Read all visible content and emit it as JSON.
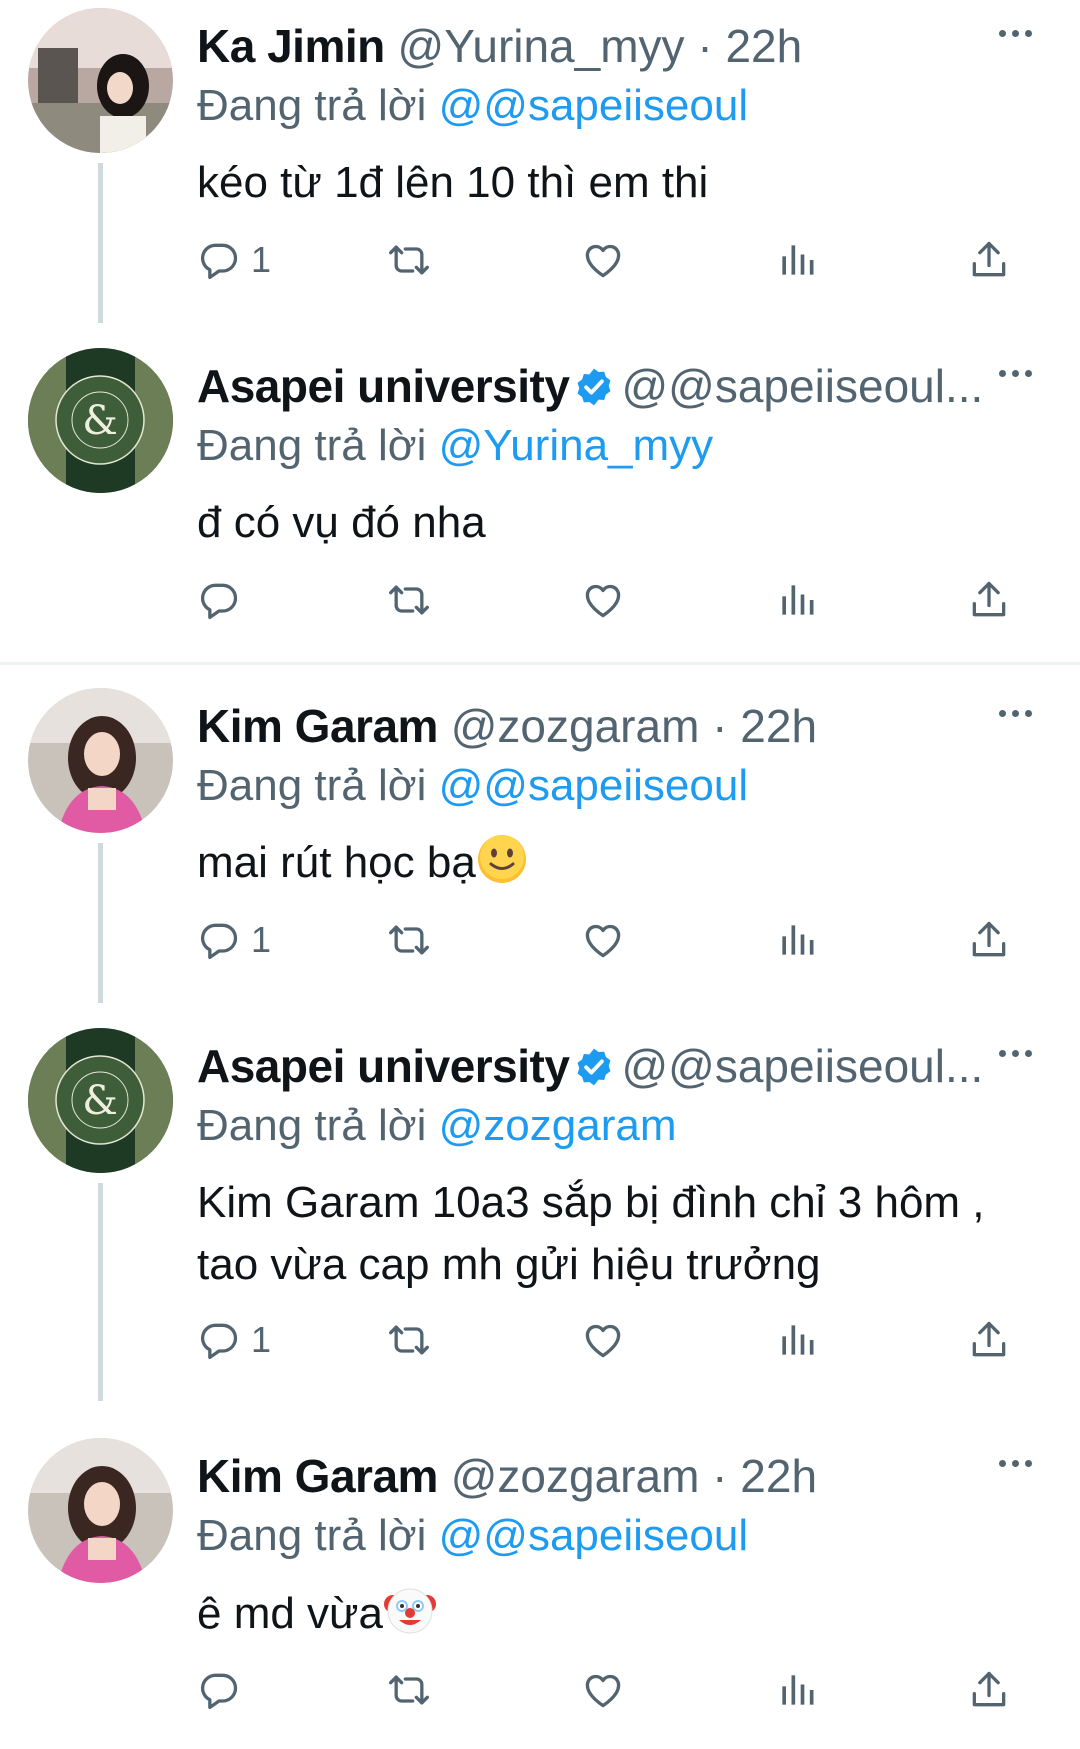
{
  "replying_prefix": "Đang trả lời",
  "tweets": [
    {
      "name": "Ka Jimin",
      "handle": "@Yurina_myy",
      "sep": "·",
      "time": "22h",
      "replying_to": "@@sapeiiseoul",
      "text": "kéo từ 1đ lên 10 thì em thi",
      "reply_count": "1"
    },
    {
      "name": "Asapei university",
      "handle": "@@sapeiiseoul...",
      "replying_to": "@Yurina_myy",
      "text": "đ có vụ đó nha",
      "reply_count": ""
    },
    {
      "name": "Kim Garam",
      "handle": "@zozgaram",
      "sep": "·",
      "time": "22h",
      "replying_to": "@@sapeiiseoul",
      "text": "mai rút học bạ",
      "emoji": "slightly-smiling-face-emoji",
      "reply_count": "1"
    },
    {
      "name": "Asapei university",
      "handle": "@@sapeiiseoul...",
      "replying_to": "@zozgaram",
      "text_line1": "Kim Garam 10a3 sắp bị đình chỉ 3 hôm ,",
      "text_line2": "tao vừa cap mh gửi hiệu trưởng",
      "reply_count": "1"
    },
    {
      "name": "Kim Garam",
      "handle": "@zozgaram",
      "sep": "·",
      "time": "22h",
      "replying_to": "@@sapeiiseoul",
      "text": "ê md vừa",
      "emoji": "clown-face-emoji",
      "reply_count": ""
    }
  ],
  "colors": {
    "accent": "#1d9bf0",
    "secondary_text": "#536471",
    "primary_text": "#0f1419",
    "thread_line": "#cfd9de"
  }
}
